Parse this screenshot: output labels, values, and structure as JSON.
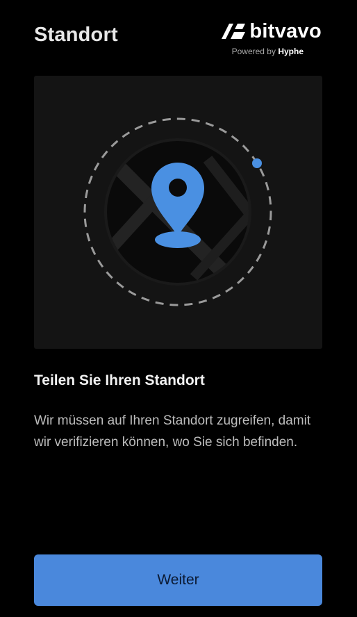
{
  "header": {
    "title": "Standort",
    "brand": {
      "name": "bitvavo",
      "powered_prefix": "Powered by",
      "powered_name": "Hyphe",
      "logo_icon": "bitvavo-logo-icon"
    }
  },
  "illustration": {
    "icon": "location-pin-icon",
    "accent_color": "#4a90e2"
  },
  "content": {
    "heading": "Teilen Sie Ihren Standort",
    "description": "Wir müssen auf Ihren Standort zugreifen, damit wir verifizieren können, wo Sie sich befinden."
  },
  "actions": {
    "continue_label": "Weiter",
    "button_color": "#4a88dc"
  }
}
